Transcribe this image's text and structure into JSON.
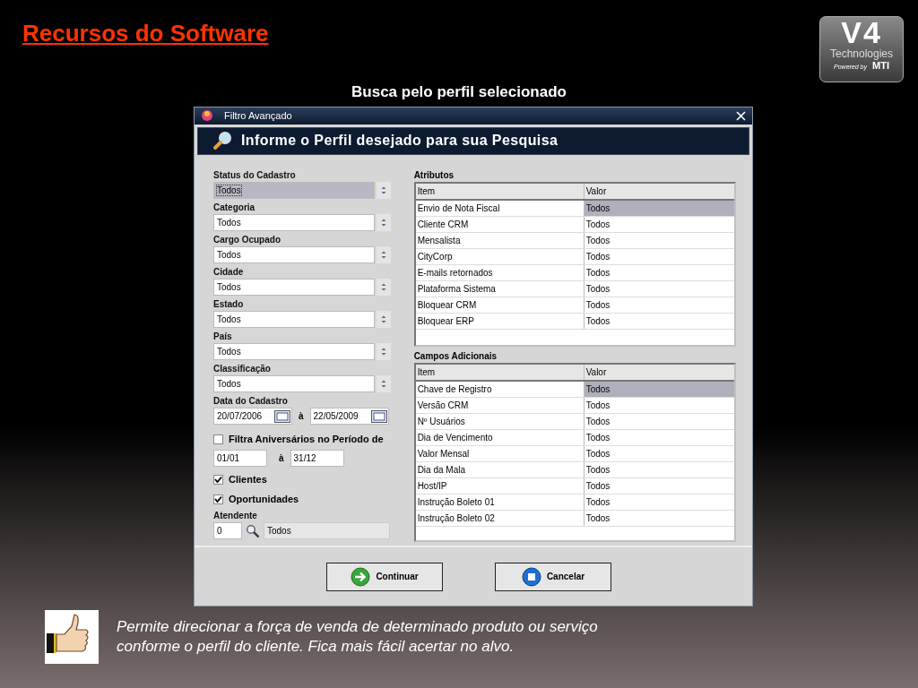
{
  "slide": {
    "title": "Recursos do Software",
    "subtitle": "Busca pelo perfil selecionado",
    "logo": {
      "mark": "V4",
      "name": "Technologies",
      "powered": "Powered by",
      "partner": "MTI"
    },
    "caption": "Permite direcionar a força de venda de determinado produto ou serviço conforme o perfil do cliente. Fica mais fácil acertar no alvo."
  },
  "window": {
    "title": "Filtro Avançado",
    "banner": "Informe o Perfil desejado para sua Pesquisa",
    "fields": [
      {
        "label": "Status do Cadastro",
        "value": "Todos",
        "focused": true
      },
      {
        "label": "Categoria",
        "value": "Todos",
        "focused": false
      },
      {
        "label": "Cargo Ocupado",
        "value": "Todos",
        "focused": false
      },
      {
        "label": "Cidade",
        "value": "Todos",
        "focused": false
      },
      {
        "label": "Estado",
        "value": "Todos",
        "focused": false
      },
      {
        "label": "País",
        "value": "Todos",
        "focused": false
      },
      {
        "label": "Classificação",
        "value": "Todos",
        "focused": false
      }
    ],
    "date_range": {
      "label": "Data do Cadastro",
      "from": "20/07/2006",
      "separator": "à",
      "to": "22/05/2009"
    },
    "birthday_filter": {
      "label": "Filtra Aniversários no Período de",
      "checked": false,
      "from": "01/01",
      "separator": "à",
      "to": "31/12"
    },
    "checkboxes": [
      {
        "label": "Clientes",
        "checked": true
      },
      {
        "label": "Oportunidades",
        "checked": true
      }
    ],
    "attendant": {
      "label": "Atendente",
      "code": "0",
      "name": "Todos"
    },
    "tables": [
      {
        "title": "Atributos",
        "columns": [
          "Item",
          "Valor"
        ],
        "rows": [
          {
            "item": "Envio de Nota Fiscal",
            "value": "Todos",
            "selected": true
          },
          {
            "item": "Cliente CRM",
            "value": "Todos",
            "selected": false
          },
          {
            "item": "Mensalista",
            "value": "Todos",
            "selected": false
          },
          {
            "item": "CityCorp",
            "value": "Todos",
            "selected": false
          },
          {
            "item": "E-mails retornados",
            "value": "Todos",
            "selected": false
          },
          {
            "item": "Plataforma Sistema",
            "value": "Todos",
            "selected": false
          },
          {
            "item": "Bloquear CRM",
            "value": "Todos",
            "selected": false
          },
          {
            "item": "Bloquear ERP",
            "value": "Todos",
            "selected": false
          }
        ]
      },
      {
        "title": "Campos Adicionais",
        "columns": [
          "Item",
          "Valor"
        ],
        "rows": [
          {
            "item": "Chave de Registro",
            "value": "Todos",
            "selected": true
          },
          {
            "item": "Versão CRM",
            "value": "Todos",
            "selected": false
          },
          {
            "item": "Nº Usuários",
            "value": "Todos",
            "selected": false
          },
          {
            "item": "Dia de Vencimento",
            "value": "Todos",
            "selected": false
          },
          {
            "item": "Valor Mensal",
            "value": "Todos",
            "selected": false
          },
          {
            "item": "Dia da Mala",
            "value": "Todos",
            "selected": false
          },
          {
            "item": "Host/IP",
            "value": "Todos",
            "selected": false
          },
          {
            "item": "Instrução Boleto 01",
            "value": "Todos",
            "selected": false
          },
          {
            "item": "Instrução Boleto 02",
            "value": "Todos",
            "selected": false
          }
        ]
      }
    ],
    "buttons": [
      {
        "label": "Continuar",
        "kind": "continue"
      },
      {
        "label": "Cancelar",
        "kind": "cancel"
      }
    ]
  }
}
